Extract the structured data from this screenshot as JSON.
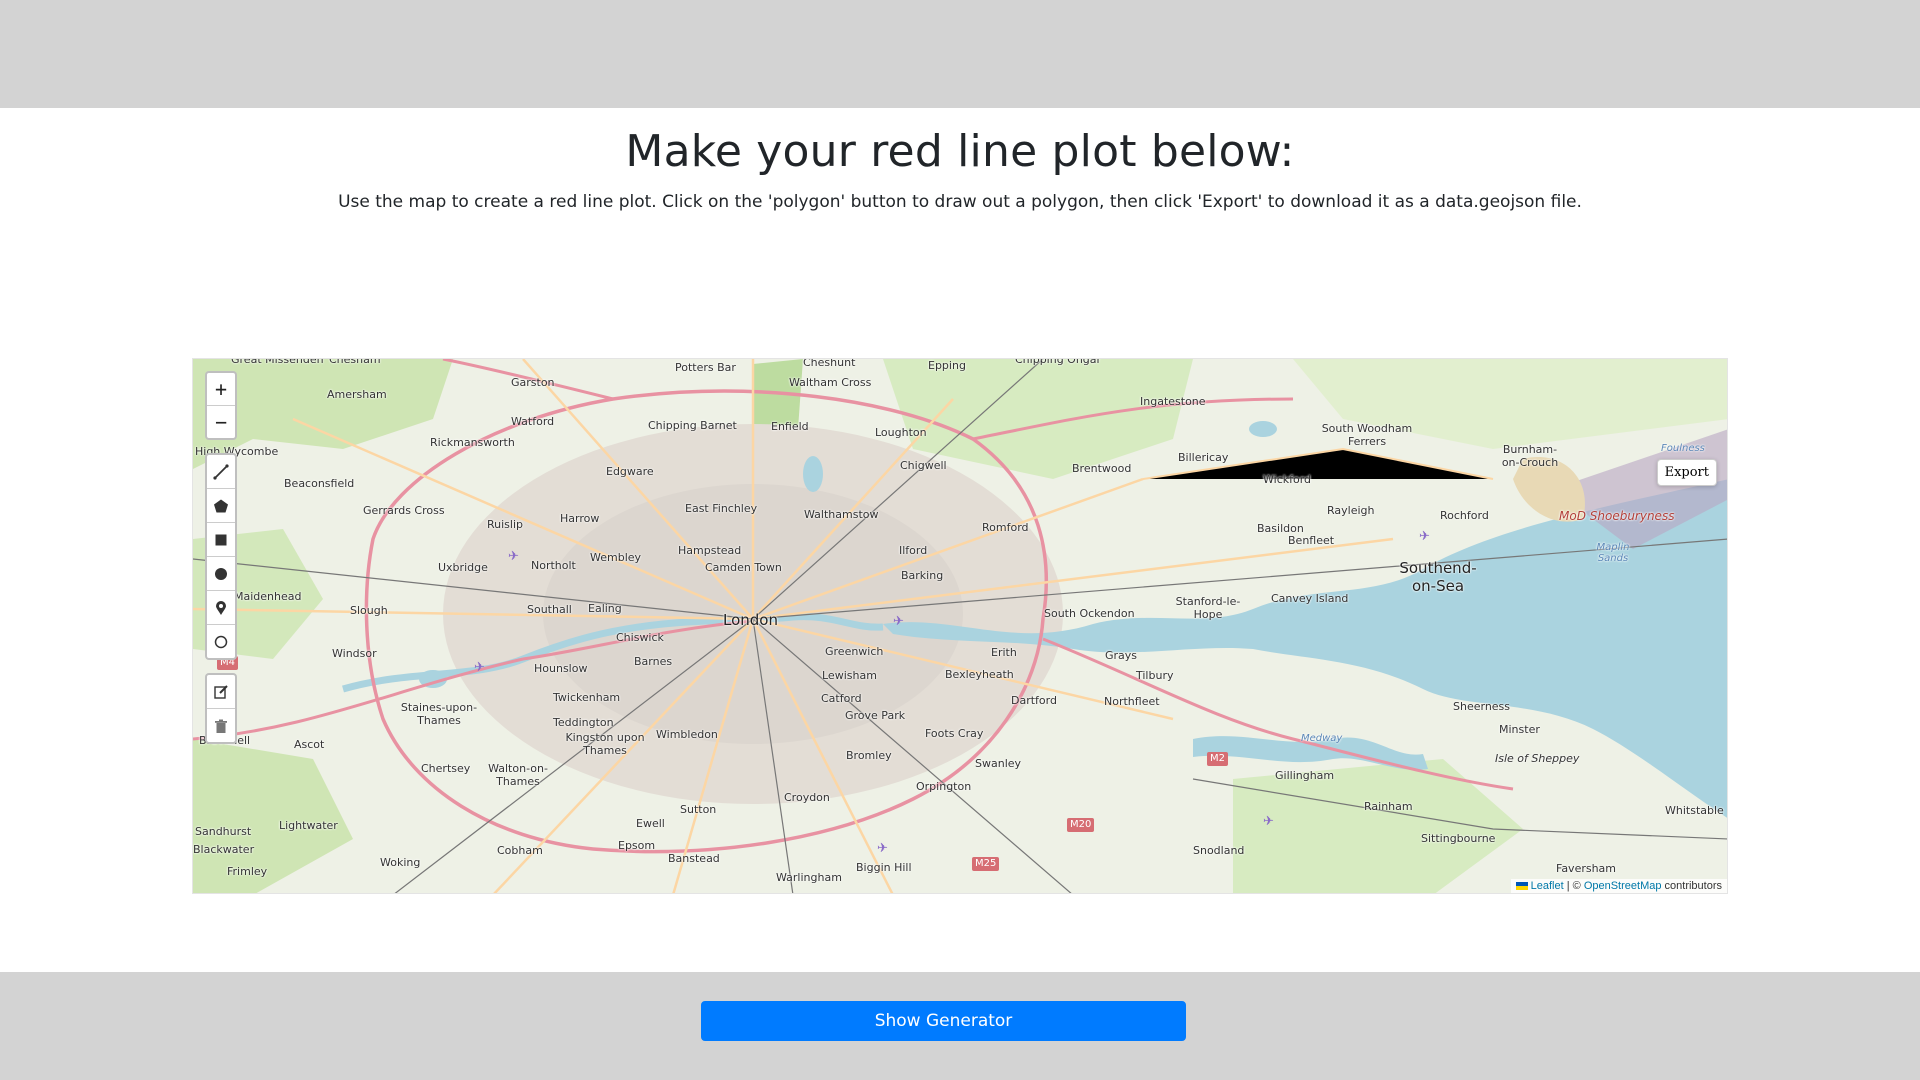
{
  "page": {
    "heading": "Make your red line plot below:",
    "instructions": "Use the map to create a red line plot. Click on the 'polygon' button to draw out a polygon, then click 'Export' to download it as a data.geojson file."
  },
  "map": {
    "zoom_in": "+",
    "zoom_out": "−",
    "export_label": "Export",
    "attribution": {
      "leaflet": "Leaflet",
      "separator": " | © ",
      "osm": "OpenStreetMap",
      "suffix": " contributors"
    },
    "draw_tools": [
      "polyline-icon",
      "polygon-icon",
      "rectangle-icon",
      "circle-icon",
      "marker-icon",
      "circlemarker-icon",
      "edit-icon",
      "delete-icon"
    ],
    "places_major": [
      "London",
      "Southend-on-Sea"
    ],
    "places": [
      "Potters Bar",
      "Cheshunt",
      "Waltham Cross",
      "Epping",
      "Amersham",
      "Garston",
      "Watford",
      "Chipping Barnet",
      "Enfield",
      "Loughton",
      "Ingatestone",
      "South Woodham Ferrers",
      "Burnham-on-Crouch",
      "Rickmansworth",
      "Edgware",
      "Chigwell",
      "Brentwood",
      "Billericay",
      "Wickford",
      "Beaconsfield",
      "Gerrards Cross",
      "Ruislip",
      "Harrow",
      "East Finchley",
      "Walthamstow",
      "Romford",
      "Rayleigh",
      "Rochford",
      "Basildon",
      "Benfleet",
      "Uxbridge",
      "Northolt",
      "Wembley",
      "Hampstead",
      "Camden Town",
      "Ilford",
      "Barking",
      "Maidenhead",
      "Slough",
      "Southall",
      "Ealing",
      "Chiswick",
      "Stanford-le-Hope",
      "Canvey Island",
      "South Ockendon",
      "Windsor",
      "Hounslow",
      "Barnes",
      "Greenwich",
      "Lewisham",
      "Erith",
      "Bexleyheath",
      "Grays",
      "Tilbury",
      "Twickenham",
      "Staines-upon-Thames",
      "Teddington",
      "Kingston upon Thames",
      "Wimbledon",
      "Catford",
      "Grove Park",
      "Dartford",
      "Northfleet",
      "Sheerness",
      "Minster",
      "Bracknell",
      "Ascot",
      "Chertsey",
      "Walton-on-Thames",
      "Foots Cray",
      "Bromley",
      "Swanley",
      "Isle of Sheppey",
      "Gillingham",
      "Orpington",
      "Croydon",
      "Sutton",
      "Ewell",
      "Rainham",
      "Whitstable",
      "Lightwater",
      "Cobham",
      "Epsom",
      "Banstead",
      "Sittingbourne",
      "Sandhurst",
      "Blackwater",
      "Woking",
      "Biggin Hill",
      "Snodland",
      "Faversham",
      "Frimley",
      "Warlingham",
      "High Wycombe",
      "Great Missenden",
      "Chesham",
      "Chipping Ongar"
    ],
    "areas": [
      "MoD Shoeburyness"
    ],
    "water": [
      "Foulness",
      "Maplin Sands",
      "Medway"
    ],
    "road_shields": [
      "M4",
      "M2",
      "M20",
      "M25"
    ]
  },
  "footer": {
    "generator_label": "Show Generator"
  },
  "colors": {
    "bar_gray": "#d3d3d3",
    "primary_blue": "#007bff",
    "water": "#aad3df",
    "land": "#eef1e6"
  }
}
